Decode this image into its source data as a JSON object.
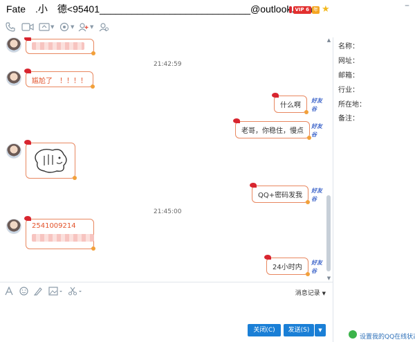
{
  "title": "Fate　.小　德<95401____________________________@outlook.com>",
  "vip": {
    "badge": "VIP 6",
    "nian": "年"
  },
  "window_controls": "–",
  "toolbar": {
    "items": [
      "phone-icon",
      "video-icon",
      "share-screen-icon",
      "remote-assist-icon",
      "add-member-icon",
      "more-apps-icon"
    ]
  },
  "messages": {
    "m1_time": "21:42:59",
    "m2_text": "尴尬了　！！！！",
    "m3_text": "什么啊",
    "m4_text": "老哥，你稳住，慢点",
    "m6_text": "QQ+密码发我",
    "m7_time": "21:45:00",
    "m8_text": "2541009214",
    "m9_text": "24小时内"
  },
  "self_badge": "好友谷",
  "sidepanel": {
    "fields": [
      "名称：",
      "网址：",
      "邮箱：",
      "行业：",
      "所在地：",
      "备注："
    ]
  },
  "input_toolbar": {
    "history_label": "消息记录"
  },
  "buttons": {
    "close_label": "关闭(C)",
    "send_label": "发送(S)"
  },
  "status": {
    "link_text": "设置我的QQ在线状态"
  },
  "colors": {
    "accent": "#1a7fd6",
    "bubble_border": "#e8875f",
    "peer_text": "#e2522a"
  }
}
